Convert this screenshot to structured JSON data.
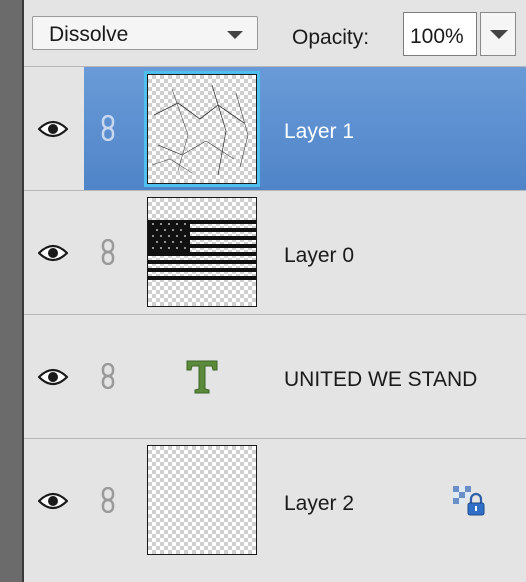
{
  "toolbar": {
    "blend_mode": "Dissolve",
    "opacity_label": "Opacity:",
    "opacity_value": "100%"
  },
  "layers": [
    {
      "name": "Layer 1",
      "selected": true,
      "thumbnail": "scratch-texture"
    },
    {
      "name": "Layer 0",
      "selected": false,
      "thumbnail": "us-flag"
    },
    {
      "name": "UNITED WE STAND",
      "selected": false,
      "thumbnail": "text-layer-icon"
    },
    {
      "name": "Layer 2",
      "selected": false,
      "thumbnail": "transparent",
      "locked": true
    }
  ],
  "icons": {
    "visibility": "eye-icon",
    "link": "chain-link-icon",
    "text_layer": "text-layer-icon",
    "lock": "transparency-lock-icon"
  },
  "colors": {
    "selection": "#5b8fd0",
    "thumb_highlight": "#4ec0f0",
    "text_icon": "#5a8a3a"
  }
}
